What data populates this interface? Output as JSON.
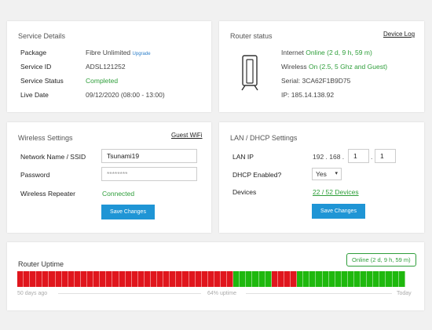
{
  "service": {
    "title": "Service Details",
    "rows": [
      {
        "label": "Package",
        "value": "Fibre Unlimited",
        "extra": "Upgrade"
      },
      {
        "label": "Service ID",
        "value": "ADSL121252"
      },
      {
        "label": "Service Status",
        "value": "Completed"
      },
      {
        "label": "Live Date",
        "value": "09/12/2020 (08:00 - 13:00)"
      }
    ]
  },
  "router": {
    "title": "Router status",
    "log_link": "Device Log",
    "internet_label": "Internet",
    "internet_value": "Online (2 d, 9 h, 59 m)",
    "wireless_label": "Wireless",
    "wireless_value": "On (2.5, 5 Ghz and Guest)",
    "serial_label": "Serial:",
    "serial_value": "3CA62F1B9D75",
    "ip_label": "IP:",
    "ip_value": "185.14.138.92"
  },
  "wireless": {
    "title": "Wireless Settings",
    "guest_link": "Guest WiFi",
    "ssid_label": "Network Name / SSID",
    "ssid_value": "Tsunami19",
    "password_label": "Password",
    "password_placeholder": "********",
    "repeater_label": "Wireless Repeater",
    "repeater_value": "Connected",
    "save_label": "Save Changes"
  },
  "lan": {
    "title": "LAN / DHCP Settings",
    "ip_label": "LAN IP",
    "ip_prefix": "192 . 168 .",
    "ip_octet3": "1",
    "ip_octet4": "1",
    "ip_sep": ".",
    "dhcp_label": "DHCP Enabled?",
    "dhcp_value": "Yes",
    "devices_label": "Devices",
    "devices_value": "22 / 52 Devices",
    "save_label": "Save Changes"
  },
  "uptime": {
    "title": "Router Uptime",
    "start_label": "50 days ago",
    "mid_label": "64% uptime",
    "end_label": "Today",
    "tooltip": "Online (2 d, 9 h, 59 m)",
    "segments": "RRRRRRRRRRRRRRRRRRRRRRRRRRRRRRRRRRGGGGGGRRRRGGGGGGGGGGGGGGGGG",
    "colors": {
      "up": "#1fb80e",
      "down": "#e0161d"
    }
  }
}
